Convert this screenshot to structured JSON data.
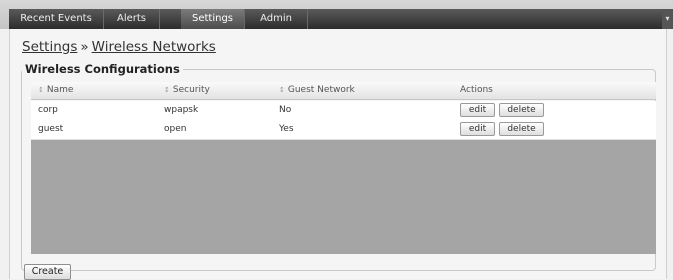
{
  "tabs": [
    {
      "label": "Recent Events"
    },
    {
      "label": "Alerts"
    },
    {
      "label": "Settings",
      "active": true
    },
    {
      "label": "Admin"
    }
  ],
  "breadcrumb": {
    "parent": "Settings",
    "separator": "»",
    "current": "Wireless Networks"
  },
  "section": {
    "title": "Wireless Configurations"
  },
  "table": {
    "sort_glyph": "↕",
    "columns": [
      "Name",
      "Security",
      "Guest Network",
      "Actions"
    ],
    "rows": [
      {
        "name": "corp",
        "security": "wpapsk",
        "guest": "No",
        "edit": "edit",
        "delete": "delete"
      },
      {
        "name": "guest",
        "security": "open",
        "guest": "Yes",
        "edit": "edit",
        "delete": "delete"
      }
    ]
  },
  "buttons": {
    "create": "Create"
  },
  "icons": {
    "corner": "menu-icon"
  },
  "colors": {
    "tabstrip": "#3a3a3a",
    "empty_area": "#a5a5a5",
    "row_bg": "#ffffff"
  }
}
